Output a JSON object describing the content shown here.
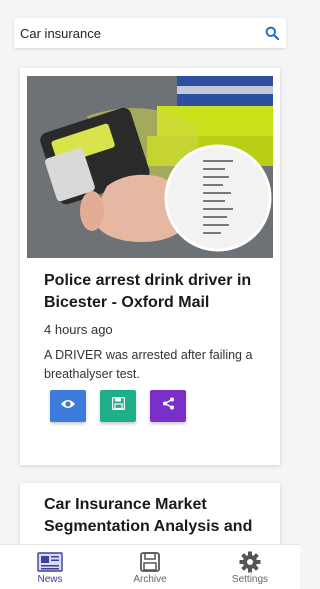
{
  "search": {
    "value": "Car insurance"
  },
  "articles": [
    {
      "title": "Police arrest drink driver in Bicester - Oxford Mail",
      "time": "4 hours ago",
      "description": "A DRIVER was arrested after failing a breathalyser test.",
      "image_icon": "breathalyser-photo"
    },
    {
      "title": "Car Insurance Market Segmentation Analysis and"
    }
  ],
  "actions": {
    "view_icon": "eye-icon",
    "save_icon": "floppy-icon",
    "share_icon": "share-icon"
  },
  "nav": {
    "items": [
      {
        "label": "News",
        "icon": "newspaper-icon",
        "active": true
      },
      {
        "label": "Archive",
        "icon": "archive-icon",
        "active": false
      },
      {
        "label": "Settings",
        "icon": "gear-icon",
        "active": false
      }
    ]
  },
  "colors": {
    "view": "#3d7bd9",
    "save": "#1fae8a",
    "share": "#7b2fc9",
    "active_nav": "#3f3f98",
    "search_icon": "#1f6fc9"
  }
}
